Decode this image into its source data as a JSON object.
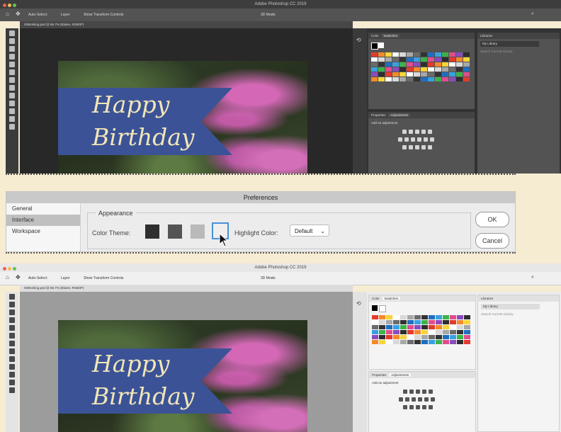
{
  "screens": {
    "top": {
      "window_title": "Adobe Photoshop CC 2019",
      "options": {
        "auto_select": "Auto-Select:",
        "layer": "Layer",
        "show_transform": "Show Transform Controls",
        "mode_3d": "3D Mode:"
      },
      "doc_tab": "03Working.psd @ 66.7% (Elaine, RGB/8*)",
      "theme": "dark"
    },
    "bottom": {
      "window_title": "Adobe Photoshop CC 2019",
      "options": {
        "auto_select": "Auto-Select:",
        "layer": "Layer",
        "show_transform": "Show Transform Controls",
        "mode_3d": "3D Mode:"
      },
      "doc_tab": "03Working.psd @ 66.7% (Elaine, RGB/8*)",
      "theme": "light"
    }
  },
  "canvas_text": {
    "line1": "Happy",
    "line2": "Birthday"
  },
  "panels": {
    "color_tab": "Color",
    "swatches_tab": "Swatches",
    "properties_tab": "Properties",
    "adjustments_tab": "Adjustments",
    "add_adjustment": "Add an adjustment",
    "libraries_tab": "Libraries",
    "library_select": "My Library",
    "search_placeholder": "Search Current Library"
  },
  "preferences": {
    "title": "Preferences",
    "sidebar": [
      "General",
      "Interface",
      "Workspace"
    ],
    "selected_index": 1,
    "section": "Appearance",
    "color_theme_label": "Color Theme:",
    "themes": [
      "#2f2f2f",
      "#545454",
      "#b9b9b9",
      "#eeeeee"
    ],
    "selected_theme": 3,
    "highlight_label": "Highlight Color:",
    "highlight_value": "Default",
    "ok": "OK",
    "cancel": "Cancel"
  },
  "swatch_colors": [
    "#e23b2e",
    "#f48a2a",
    "#f7d53a",
    "#ffffff",
    "#d9d9d9",
    "#a8a8a8",
    "#6b6b6b",
    "#333333",
    "#1f6fbf",
    "#39a0e0",
    "#3bb34a",
    "#e04d8e",
    "#8a4bbd",
    "#2d2d2d"
  ]
}
